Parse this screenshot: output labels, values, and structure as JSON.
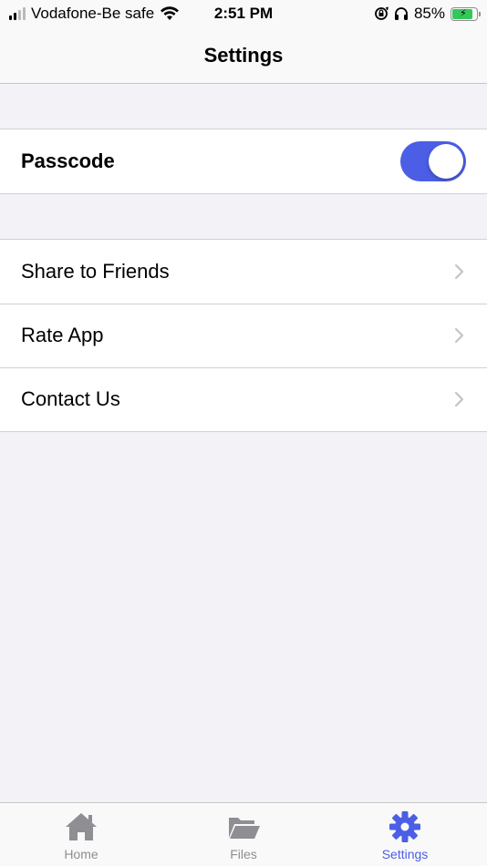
{
  "status_bar": {
    "carrier": "Vodafone-Be safe",
    "time": "2:51 PM",
    "battery_percent": "85%",
    "battery_level": 0.85,
    "icons": [
      "signal-icon",
      "wifi-icon",
      "orientation-lock-icon",
      "headphones-icon",
      "battery-icon"
    ]
  },
  "nav": {
    "title": "Settings"
  },
  "passcode": {
    "label": "Passcode",
    "enabled": true
  },
  "menu": {
    "items": [
      {
        "label": "Share to Friends"
      },
      {
        "label": "Rate App"
      },
      {
        "label": "Contact Us"
      }
    ]
  },
  "tab_bar": {
    "tabs": [
      {
        "label": "Home",
        "icon": "home-icon",
        "active": false
      },
      {
        "label": "Files",
        "icon": "folder-icon",
        "active": false
      },
      {
        "label": "Settings",
        "icon": "gear-icon",
        "active": true
      }
    ]
  },
  "colors": {
    "accent": "#4b5ee5",
    "inactive": "#8e8e93",
    "background": "#f2f2f7",
    "battery": "#34c759"
  }
}
